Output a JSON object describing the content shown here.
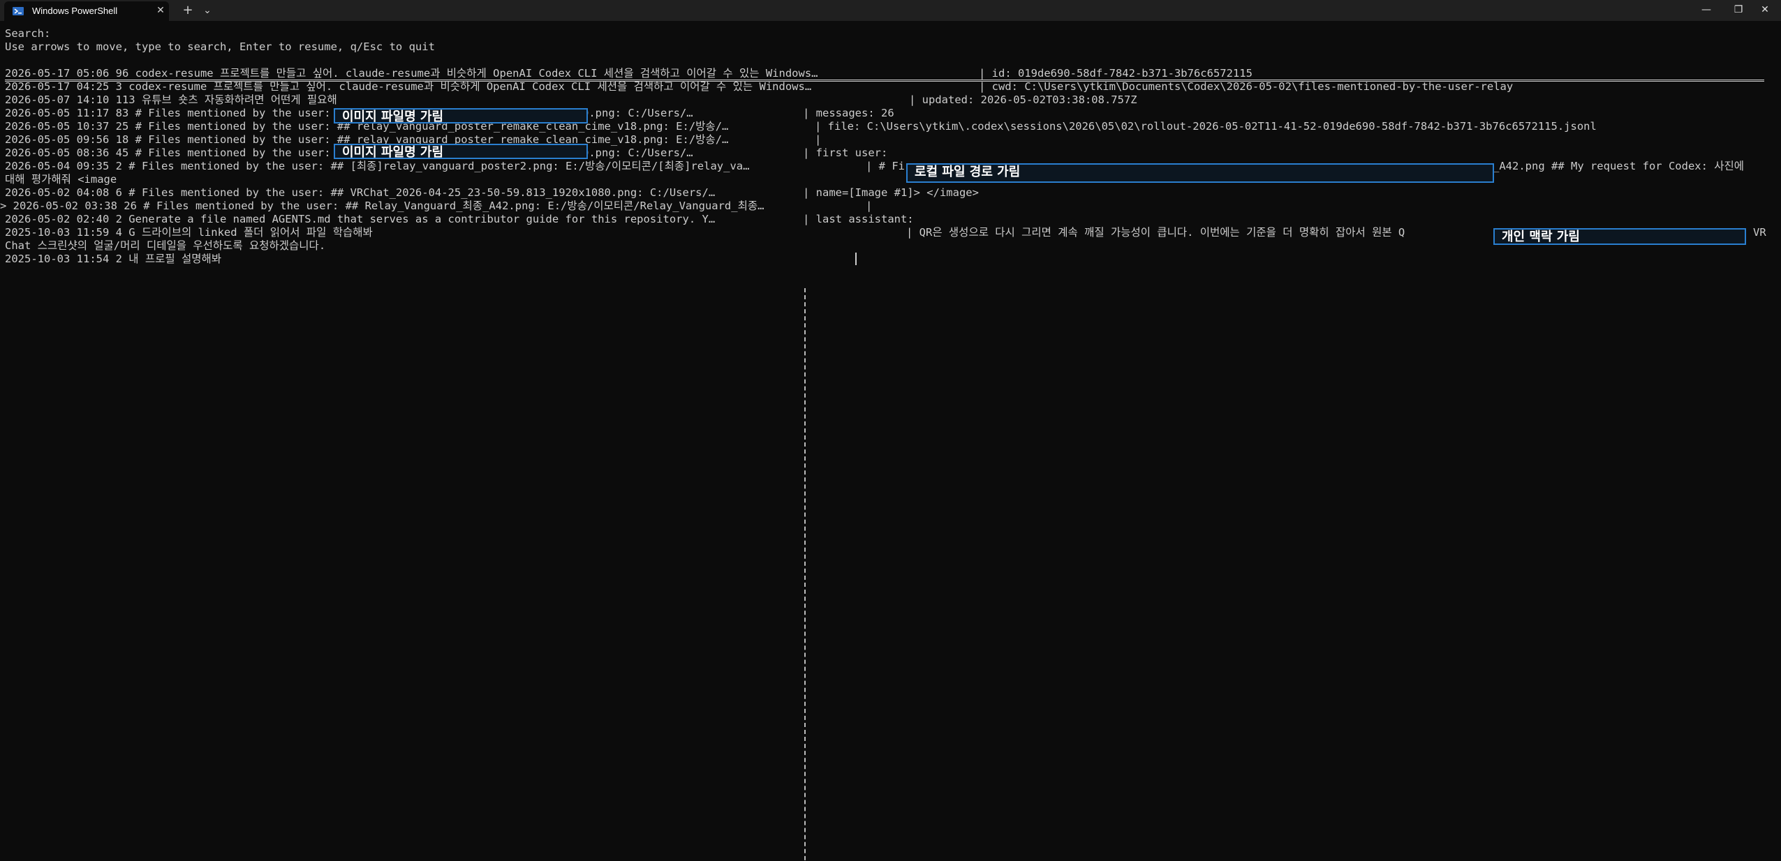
{
  "window": {
    "tab_title": "Windows PowerShell",
    "tab_icon": "powershell-icon",
    "close_tab_glyph": "✕",
    "new_tab_glyph": "+",
    "dropdown_glyph": "⌄",
    "minimize_glyph": "—",
    "restore_glyph": "❐",
    "close_glyph": "✕"
  },
  "header": {
    "search_label": "Search:",
    "instructions": "Use arrows to move, type to search, Enter to resume, q/Esc to quit"
  },
  "sessions": [
    "2026-05-17 05:06 96 codex-resume 프로젝트를 만들고 싶어. claude-resume과 비슷하게 OpenAI Codex CLI 세션을 검색하고 이어갈 수 있는 Windows…",
    "2026-05-17 04:25 3 codex-resume 프로젝트를 만들고 싶어. claude-resume과 비슷하게 OpenAI Codex CLI 세션을 검색하고 이어갈 수 있는 Windows…",
    "2026-05-07 14:10 113 유튜브 숏츠 자동화하려면 어떤게 필요해",
    "2026-05-05 11:17 83 # Files mentioned by the user: ## ",
    "2026-05-05 10:37 25 # Files mentioned by the user: ## relay_vanguard_poster_remake_clean_cime_v18.png: E:/방송/…",
    "2026-05-05 09:56 18 # Files mentioned by the user: ## relay_vanguard_poster_remake_clean_cime_v18.png: E:/방송/…",
    "2026-05-05 08:36 45 # Files mentioned by the user: ## ",
    "2026-05-04 09:35 2 # Files mentioned by the user: ## [최종]relay_vanguard_poster2.png: E:/방송/이모티콘/[최종]relay_va…",
    "대해 평가해줘 <image",
    "2026-05-02 04:08 6 # Files mentioned by the user: ## VRChat_2026-04-25_23-50-59.813_1920x1080.png: C:/Users/…",
    "> 2026-05-02 03:38 26 # Files mentioned by the user: ## Relay_Vanguard_최종_A42.png: E:/방송/이모티콘/Relay_Vanguard_최종…",
    "2026-05-02 02:40 2 Generate a file named AGENTS.md that serves as a contributor guide for this repository. Y…",
    "2025-10-03 11:59 4 G 드라이브의 linked 폴더 읽어서 파일 학습해봐",
    "Chat 스크린샷의 얼굴/머리 디테일을 우선하도록 요청하겠습니다.",
    "2025-10-03 11:54 2 내 프로필 설명해봐"
  ],
  "session_tails": {
    "row4": "0.png: C:/Users/…",
    "row7": "0.png: C:/Users/…"
  },
  "preview": {
    "id_line": "| id: 019de690-58df-7842-b371-3b76c6572115",
    "cwd_line": "| cwd: C:\\Users\\ytkim\\Documents\\Codex\\2026-05-02\\files-mentioned-by-the-user-relay",
    "updated_line": "| updated: 2026-05-02T03:38:08.757Z",
    "messages_line": "| messages: 26",
    "file_line": "| file: C:\\Users\\ytkim\\.codex\\sessions\\2026\\05\\02\\rollout-2026-05-02T11-41-52-019de690-58df-7842-b371-3b76c6572115.jsonl",
    "pipe": "|",
    "first_user_label": "| first user:",
    "first_user_prefix": "| # Fi",
    "first_user_suffix": "_A42.png ## My request for Codex: 사진에",
    "first_user_cont": "| name=[Image #1]> </image>",
    "first_user_pipe": "|",
    "last_assistant_label": "| last assistant:",
    "last_assistant_text": "| QR은 생성으로 다시 그리면 계속 깨질 가능성이 큽니다. 이번에는 기준을 더 명확히 잡아서 원본 Q",
    "last_assistant_tail": "VR"
  },
  "redactions": {
    "image_filename": "이미지 파일명 가림",
    "local_path": "로컬 파일 경로 가림",
    "personal_context": "개인 맥락 가림"
  }
}
